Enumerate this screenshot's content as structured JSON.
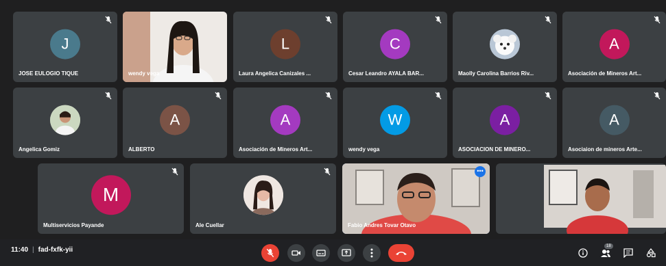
{
  "participants": [
    {
      "name": "JOSE EULOGIO TIQUE",
      "initial": "J",
      "color": "#4a7a8c"
    },
    {
      "name": "wendy vega",
      "initial": "",
      "color": ""
    },
    {
      "name": "Laura Angelica Canizales ...",
      "initial": "L",
      "color": "#6d3f2e"
    },
    {
      "name": "Cesar Leandro AYALA BAR...",
      "initial": "C",
      "color": "#a43ac0"
    },
    {
      "name": "Maolly Carolina Barrios Riv...",
      "initial": "",
      "color": ""
    },
    {
      "name": "Asociación de Mineros Art...",
      "initial": "A",
      "color": "#c2185b"
    },
    {
      "name": "Angelica Gomiz",
      "initial": "",
      "color": ""
    },
    {
      "name": "ALBERTO",
      "initial": "A",
      "color": "#7b5346"
    },
    {
      "name": "Asociación de Mineros Art...",
      "initial": "A",
      "color": "#a43ac0"
    },
    {
      "name": "wendy vega",
      "initial": "W",
      "color": "#039be5"
    },
    {
      "name": "ASOCIACION DE MINERO...",
      "initial": "A",
      "color": "#7b1fa2"
    },
    {
      "name": "Asociaion de mineros Arte...",
      "initial": "A",
      "color": "#455a64"
    },
    {
      "name": "Multiservicios Payande",
      "initial": "M",
      "color": "#c2185b"
    },
    {
      "name": "Ale Cuellar",
      "initial": "",
      "color": ""
    },
    {
      "name": "Fabio Andres Tovar Otavo",
      "initial": "",
      "color": ""
    },
    {
      "name": "",
      "initial": "",
      "color": ""
    }
  ],
  "bottom_bar": {
    "time": "11:40",
    "separator": "|",
    "meeting_code": "fad-fxfk-yii",
    "participant_count": "18"
  },
  "colors": {
    "tile_bg": "#3c4043",
    "bar_bg": "#202124",
    "hangup": "#ea4335",
    "active_border": "#8ab4f8"
  }
}
